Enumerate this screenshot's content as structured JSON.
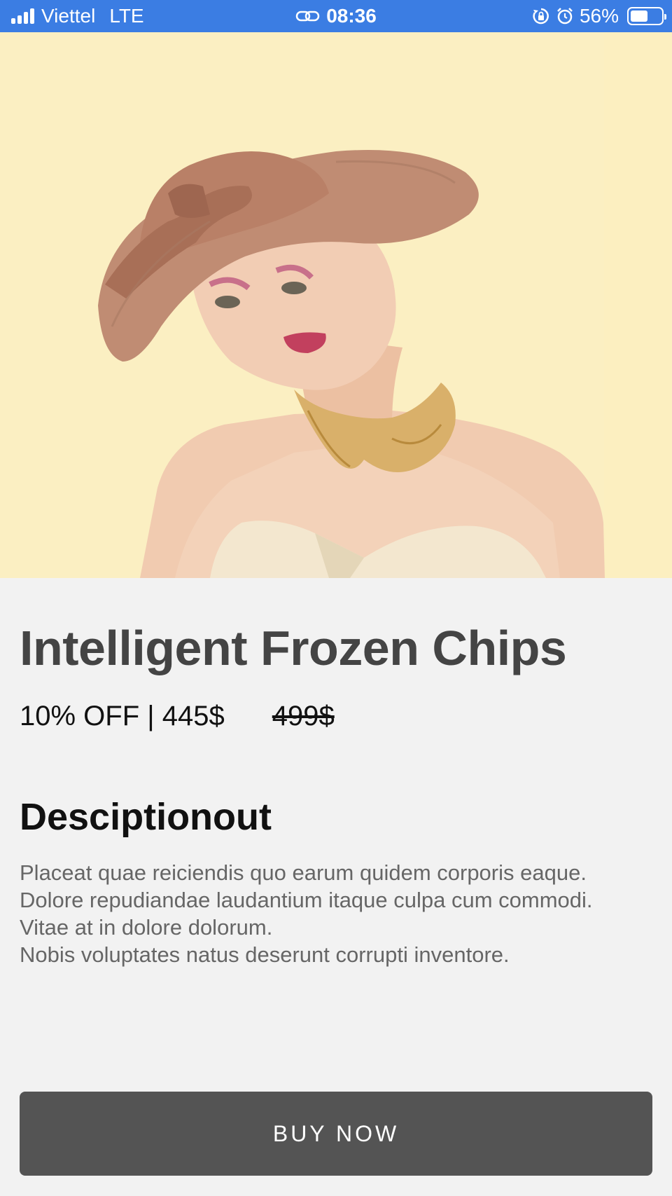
{
  "status_bar": {
    "carrier": "Viettel",
    "network": "LTE",
    "time": "08:36",
    "battery": "56%",
    "battery_level": 0.56,
    "icons": [
      "signal-icon",
      "link-icon",
      "rotation-lock-icon",
      "alarm-icon",
      "battery-icon"
    ]
  },
  "hero": {
    "image": "model-wearing-wide-brim-hat-photo",
    "background_color": "#fbefc2"
  },
  "product": {
    "title": "Intelligent Frozen Chips",
    "discount_price": "10% OFF | 445$",
    "original_price": "499$"
  },
  "description": {
    "heading": "Desciptionout",
    "lines": [
      "Placeat quae reiciendis quo earum quidem corporis eaque.",
      "Dolore repudiandae laudantium itaque culpa cum commodi.",
      "Vitae at in dolore dolorum.",
      "Nobis voluptates natus deserunt corrupti inventore."
    ]
  },
  "actions": {
    "buy_label": "BUY NOW"
  },
  "colors": {
    "status_bar": "#3b7de3",
    "page_background": "#f2f2f2",
    "button": "#545454",
    "title": "#444444"
  }
}
